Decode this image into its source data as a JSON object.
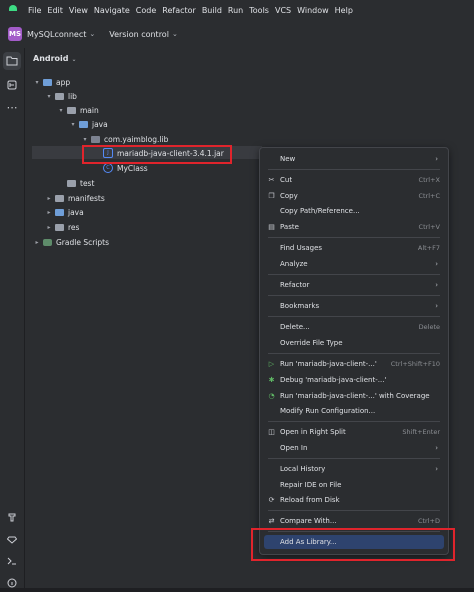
{
  "menubar": {
    "items": [
      "File",
      "Edit",
      "View",
      "Navigate",
      "Code",
      "Refactor",
      "Build",
      "Run",
      "Tools",
      "VCS",
      "Window",
      "Help"
    ]
  },
  "toolbar": {
    "project_badge": "MS",
    "project_name": "MySQLconnect",
    "version_control": "Version control"
  },
  "panel": {
    "title": "Android"
  },
  "tree": {
    "app": "app",
    "lib": "lib",
    "main": "main",
    "java": "java",
    "package": "com.yaimblog.lib",
    "jar": "mariadb-java-client-3.4.1.jar",
    "myclass": "MyClass",
    "test": "test",
    "manifests": "manifests",
    "java2": "java",
    "res": "res",
    "gradle": "Gradle Scripts"
  },
  "context_menu": {
    "new": "New",
    "cut": "Cut",
    "cut_sc": "Ctrl+X",
    "copy": "Copy",
    "copy_sc": "Ctrl+C",
    "copy_path": "Copy Path/Reference...",
    "paste": "Paste",
    "paste_sc": "Ctrl+V",
    "find_usages": "Find Usages",
    "find_usages_sc": "Alt+F7",
    "analyze": "Analyze",
    "refactor": "Refactor",
    "bookmarks": "Bookmarks",
    "delete": "Delete...",
    "delete_sc": "Delete",
    "override": "Override File Type",
    "run": "Run 'mariadb-java-client-...'",
    "run_sc": "Ctrl+Shift+F10",
    "debug": "Debug 'mariadb-java-client-...'",
    "coverage": "Run 'mariadb-java-client-...' with Coverage",
    "modify_run": "Modify Run Configuration...",
    "open_split": "Open in Right Split",
    "open_split_sc": "Shift+Enter",
    "open_in": "Open In",
    "local_history": "Local History",
    "repair": "Repair IDE on File",
    "reload": "Reload from Disk",
    "compare": "Compare With...",
    "compare_sc": "Ctrl+D",
    "add_library": "Add As Library..."
  },
  "colors": {
    "highlight_box": "#e0242c",
    "selection": "#2e436e"
  }
}
